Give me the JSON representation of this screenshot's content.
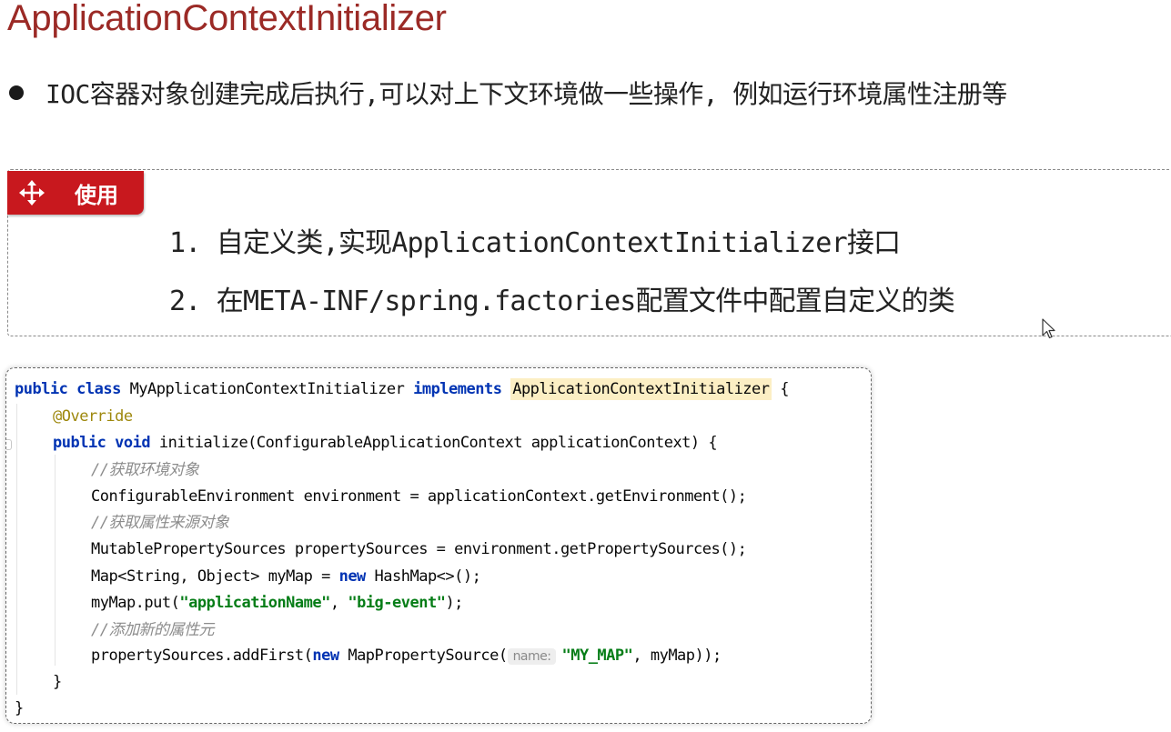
{
  "title": "ApplicationContextInitializer",
  "bullet": "IOC容器对象创建完成后执行,可以对上下文环境做一些操作, 例如运行环境属性注册等",
  "usage": {
    "tag_label": "使用",
    "tag_icon": "move-arrows-icon",
    "tag_color": "#c8181e",
    "steps": [
      "1. 自定义类,实现ApplicationContextInitializer接口",
      "2. 在META-INF/spring.factories配置文件中配置自定义的类"
    ]
  },
  "code": {
    "l1": {
      "kw1": "public class",
      "cls": " MyApplicationContextInitializer ",
      "kw2": "implements",
      "sp": " ",
      "iface": "ApplicationContextInitializer",
      "end": " {"
    },
    "l2": {
      "ann": "@Override"
    },
    "l3": {
      "kw": "public void",
      "rest": " initialize(ConfigurableApplicationContext applicationContext) {"
    },
    "l4": {
      "cm": "//获取环境对象"
    },
    "l5": {
      "text": "ConfigurableEnvironment environment = applicationContext.getEnvironment();"
    },
    "l6": {
      "cm": "//获取属性来源对象"
    },
    "l7": {
      "text": "MutablePropertySources propertySources = environment.getPropertySources();"
    },
    "l8": {
      "a": "Map<String, Object> myMap = ",
      "kw": "new",
      "b": " HashMap<>();"
    },
    "l9": {
      "a": "myMap.put(",
      "s1": "\"applicationName\"",
      "b": ", ",
      "s2": "\"big-event\"",
      "c": ");"
    },
    "l10": {
      "cm": "//添加新的属性元"
    },
    "l11": {
      "a": "propertySources.addFirst(",
      "kw": "new",
      "b": " MapPropertySource(",
      "hint": "name:",
      "s": "\"MY_MAP\"",
      "c": ", myMap));"
    },
    "l12": {
      "text": "}"
    },
    "l13": {
      "text": "}"
    }
  },
  "colors": {
    "title": "#9b2a26",
    "keyword": "#0033b3",
    "annotation": "#9e880d",
    "comment": "#8c8c8c",
    "string": "#067d17",
    "highlight": "#fcefc4"
  }
}
